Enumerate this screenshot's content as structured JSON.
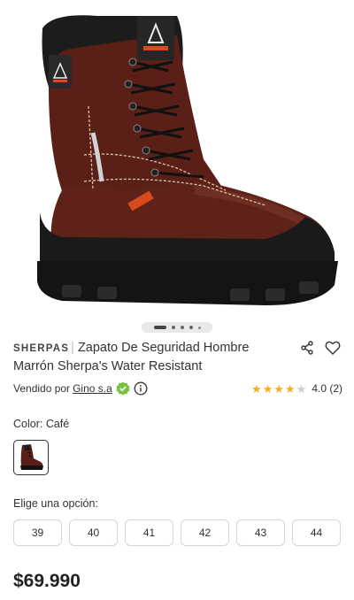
{
  "product": {
    "brand": "SHERPAS",
    "brand_separator": "|",
    "title": "Zapato De Seguridad Hombre Marrón Sherpa's Water Resistant",
    "boot_label": "SHERPAS",
    "image_alt": "Bota de seguridad marrón"
  },
  "carousel": {
    "total": 5,
    "active_index": 0
  },
  "seller": {
    "prefix": "Vendido por",
    "name": "Gino s.a"
  },
  "rating": {
    "score": 4.0,
    "max": 5,
    "text": "4.0 (2)"
  },
  "color": {
    "label": "Color: Café"
  },
  "options": {
    "label": "Elige una opción:",
    "sizes": [
      "39",
      "40",
      "41",
      "42",
      "43",
      "44"
    ]
  },
  "price": "$69.990",
  "colors": {
    "leather": "#5a1f17",
    "sole": "#1a1a1a",
    "star": "#f2b01e",
    "verified": "#7ac142"
  }
}
